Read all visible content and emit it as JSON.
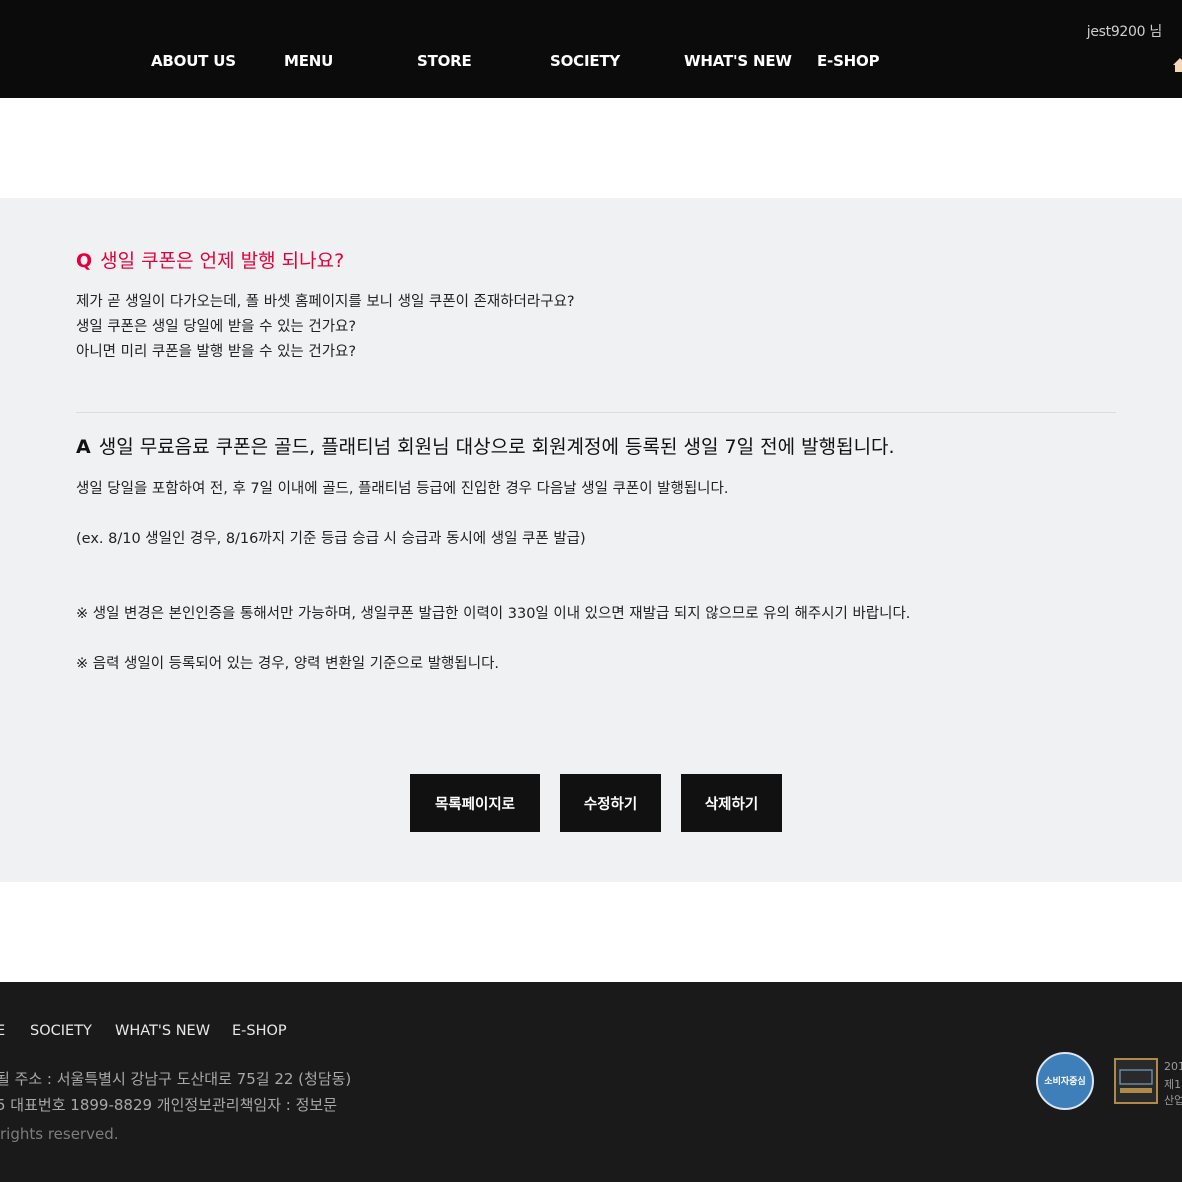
{
  "header": {
    "user_id": "jest9200",
    "user_suffix": "님",
    "nav": [
      "ABOUT US",
      "MENU",
      "STORE",
      "SOCIETY",
      "WHAT'S NEW",
      "E-SHOP"
    ]
  },
  "question": {
    "mark": "Q",
    "title": "생일 쿠폰은 언제 발행 되나요?",
    "lines": [
      "제가 곧 생일이 다가오는데, 폴 바셋 홈페이지를 보니 생일 쿠폰이 존재하더라구요?",
      "생일 쿠폰은 생일 당일에 받을 수 있는 건가요?",
      "아니면 미리 쿠폰을 발행 받을 수 있는 건가요?"
    ]
  },
  "answer": {
    "mark": "A",
    "title": "생일 무료음료 쿠폰은 골드, 플래티넘 회원님 대상으로 회원계정에 등록된 생일 7일 전에 발행됩니다.",
    "lines": [
      "생일 당일을 포함하여 전, 후 7일 이내에 골드, 플래티넘 등급에 진입한 경우 다음날 생일 쿠폰이 발행됩니다.",
      "(ex. 8/10 생일인 경우, 8/16까지 기준 등급 승급 시 승급과 동시에 생일 쿠폰 발급)",
      "※ 생일 변경은 본인인증을 통해서만 가능하며, 생일쿠폰 발급한 이력이 330일 이내 있으면 재발급 되지 않으므로 유의 해주시기 바랍니다.",
      "※ 음력 생일이 등록되어 있는 경우, 양력 변환일 기준으로 발행됩니다."
    ]
  },
  "buttons": {
    "list": "목록페이지로",
    "edit": "수정하기",
    "delete": "삭제하기"
  },
  "footer": {
    "nav_partial": "E",
    "nav": [
      "SOCIETY",
      "WHAT'S NEW",
      "E-SHOP"
    ],
    "address": "될 주소 : 서울특별시 강남구 도산대로 75길 22 (청담동)",
    "phone": "5 대표번호 1899-8829 개인정보관리책임자 : 정보문",
    "copyright": "rights reserved.",
    "ccm_badge": "소비자중심",
    "side_lines": [
      "201",
      "제1",
      "산업"
    ]
  },
  "colors": {
    "header_bg": "#0b0b0b",
    "question_accent": "#e4003a",
    "content_bg": "#f0f1f3",
    "footer_bg": "#1a1a1a",
    "button_bg": "#111111"
  },
  "icons": {
    "home": "home-icon",
    "ccm": "ccm-award-badge",
    "brand": "brand-award-badge"
  }
}
